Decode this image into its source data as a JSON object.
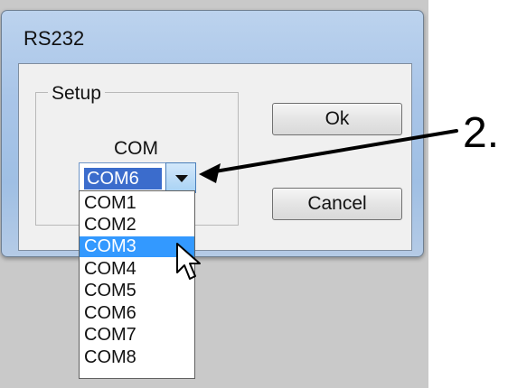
{
  "window": {
    "title": "RS232"
  },
  "setup": {
    "group_label": "Setup",
    "com_label": "COM",
    "selected_port": "COM6"
  },
  "buttons": {
    "ok": "Ok",
    "cancel": "Cancel"
  },
  "dropdown": {
    "options": [
      "COM1",
      "COM2",
      "COM3",
      "COM4",
      "COM5",
      "COM6",
      "COM7",
      "COM8"
    ],
    "highlighted_option": "COM3"
  },
  "annotation": {
    "step_label": "2."
  },
  "icons": {
    "dropdown_arrow": "chevron-down-icon",
    "mouse_cursor": "mouse-pointer-icon",
    "annotation_arrow": "annotation-arrow-icon"
  },
  "colors": {
    "selection": "#3399ff",
    "combo_selection": "#3b6ccc",
    "dialog_frame": "#a9c5e8"
  }
}
